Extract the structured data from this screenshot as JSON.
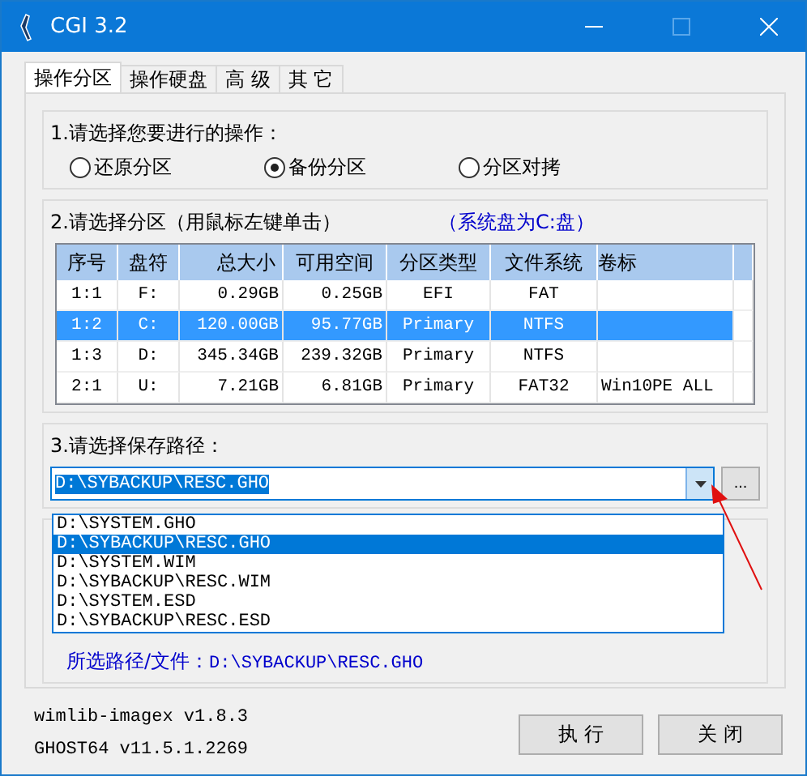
{
  "window": {
    "title": "CGI 3.2"
  },
  "tabs": [
    {
      "label": "操作分区",
      "selected": true
    },
    {
      "label": "操作硬盘",
      "selected": false
    },
    {
      "label": "高 级",
      "selected": false
    },
    {
      "label": "其 它",
      "selected": false
    }
  ],
  "operation": {
    "label": "1.请选择您要进行的操作：",
    "options": [
      {
        "label": "还原分区",
        "selected": false
      },
      {
        "label": "备份分区",
        "selected": true
      },
      {
        "label": "分区对拷",
        "selected": false
      }
    ]
  },
  "partitions": {
    "label": "2.请选择分区（用鼠标左键单击）",
    "system_note": "（系统盘为C:盘）",
    "columns": [
      "序号",
      "盘符",
      "总大小",
      "可用空间",
      "分区类型",
      "文件系统",
      "卷标"
    ],
    "rows": [
      {
        "cells": [
          "1:1",
          "F:",
          "0.29GB",
          "0.25GB",
          "EFI",
          "FAT",
          ""
        ],
        "selected": false
      },
      {
        "cells": [
          "1:2",
          "C:",
          "120.00GB",
          "95.77GB",
          "Primary",
          "NTFS",
          ""
        ],
        "selected": true
      },
      {
        "cells": [
          "1:3",
          "D:",
          "345.34GB",
          "239.32GB",
          "Primary",
          "NTFS",
          ""
        ],
        "selected": false
      },
      {
        "cells": [
          "2:1",
          "U:",
          "7.21GB",
          "6.81GB",
          "Primary",
          "FAT32",
          "Win10PE ALL"
        ],
        "selected": false
      }
    ]
  },
  "save_path": {
    "label": "3.请选择保存路径：",
    "value": "D:\\SYBACKUP\\RESC.GHO",
    "browse": "...",
    "expanded": true,
    "options": [
      {
        "label": "D:\\SYSTEM.GHO",
        "selected": false
      },
      {
        "label": "D:\\SYBACKUP\\RESC.GHO",
        "selected": true
      },
      {
        "label": "D:\\SYSTEM.WIM",
        "selected": false
      },
      {
        "label": "D:\\SYBACKUP\\RESC.WIM",
        "selected": false
      },
      {
        "label": "D:\\SYSTEM.ESD",
        "selected": false
      },
      {
        "label": "D:\\SYBACKUP\\RESC.ESD",
        "selected": false
      }
    ],
    "selected_label": "所选路径/文件：",
    "selected_value": "D:\\SYBACKUP\\RESC.GHO"
  },
  "versions": [
    "wimlib-imagex v1.8.3",
    "GHOST64 v11.5.1.2269"
  ],
  "buttons": [
    "执 行",
    "关 闭"
  ]
}
